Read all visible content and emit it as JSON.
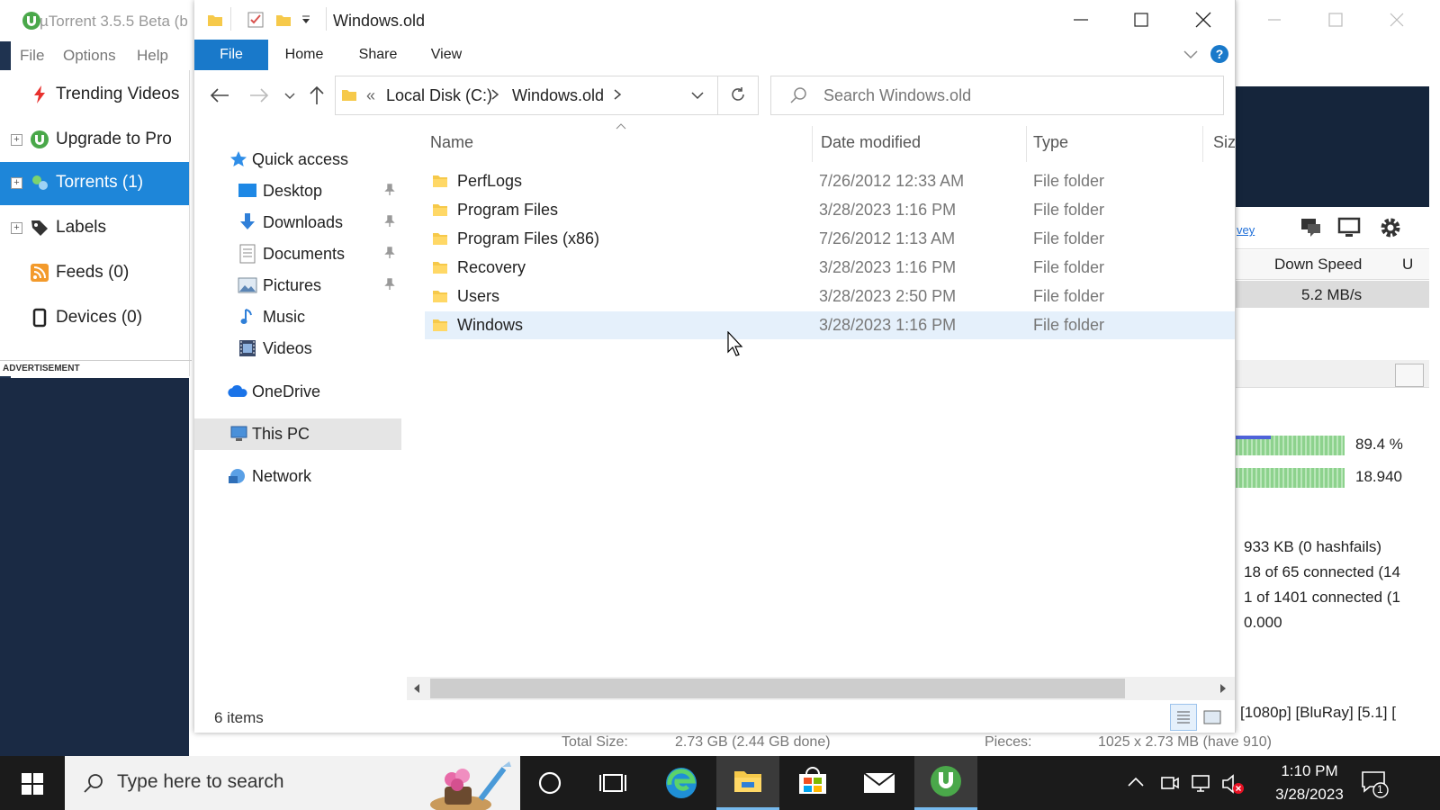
{
  "utorrent": {
    "title": "µTorrent 3.5.5 Beta (b",
    "menu": [
      "File",
      "Options",
      "Help"
    ],
    "sidebar": [
      {
        "label": "Trending Videos",
        "icon": "lightning-icon",
        "expandable": false,
        "selected": false
      },
      {
        "label": "Upgrade to Pro",
        "icon": "utorrent-logo-icon",
        "expandable": true,
        "selected": false
      },
      {
        "label": "Torrents (1)",
        "icon": "torrents-icon",
        "expandable": true,
        "selected": true
      },
      {
        "label": "Labels",
        "icon": "tag-icon",
        "expandable": true,
        "selected": false
      },
      {
        "label": "Feeds (0)",
        "icon": "rss-icon",
        "expandable": false,
        "selected": false
      },
      {
        "label": "Devices (0)",
        "icon": "device-icon",
        "expandable": false,
        "selected": false
      }
    ],
    "advertisement_label": "ADVERTISEMENT",
    "survey_link": "vey",
    "columns": {
      "down_speed": "Down Speed",
      "next": "U"
    },
    "torrent_row": {
      "down_speed": "5.2 MB/s"
    },
    "progress": {
      "availability_percent": "89.4 %",
      "availability_value": "18.940",
      "fill": 0.894
    },
    "info_lines": [
      "933 KB (0 hashfails)",
      "18 of 65 connected (14",
      "1 of 1401 connected (1",
      "0.000"
    ],
    "bottom_text": "[1080p] [BluRay] [5.1] [",
    "general": {
      "total_size_label": "Total Size:",
      "total_size_value": "2.73 GB (2.44 GB done)",
      "pieces_label": "Pieces:",
      "pieces_value": "1025 x 2.73 MB (have 910)"
    }
  },
  "explorer": {
    "title": "Windows.old",
    "ribbon_tabs": [
      "File",
      "Home",
      "Share",
      "View"
    ],
    "address": {
      "overflow": "«",
      "crumbs": [
        "Local Disk (C:)",
        "Windows.old"
      ]
    },
    "search_placeholder": "Search Windows.old",
    "tree": [
      {
        "label": "Quick access",
        "icon": "star-icon",
        "indent": 1,
        "pinned": false
      },
      {
        "label": "Desktop",
        "icon": "desktop-icon",
        "indent": 2,
        "pinned": true
      },
      {
        "label": "Downloads",
        "icon": "download-icon",
        "indent": 2,
        "pinned": true
      },
      {
        "label": "Documents",
        "icon": "documents-icon",
        "indent": 2,
        "pinned": true
      },
      {
        "label": "Pictures",
        "icon": "pictures-icon",
        "indent": 2,
        "pinned": true
      },
      {
        "label": "Music",
        "icon": "music-icon",
        "indent": 2,
        "pinned": false
      },
      {
        "label": "Videos",
        "icon": "videos-icon",
        "indent": 2,
        "pinned": false
      },
      {
        "label": "OneDrive",
        "icon": "cloud-icon",
        "indent": 1,
        "pinned": false
      },
      {
        "label": "This PC",
        "icon": "computer-icon",
        "indent": 1,
        "pinned": false,
        "selected": true
      },
      {
        "label": "Network",
        "icon": "network-icon",
        "indent": 1,
        "pinned": false
      }
    ],
    "columns": [
      "Name",
      "Date modified",
      "Type",
      "Size"
    ],
    "files": [
      {
        "name": "PerfLogs",
        "date": "7/26/2012 12:33 AM",
        "type": "File folder"
      },
      {
        "name": "Program Files",
        "date": "3/28/2023 1:16 PM",
        "type": "File folder"
      },
      {
        "name": "Program Files (x86)",
        "date": "7/26/2012 1:13 AM",
        "type": "File folder"
      },
      {
        "name": "Recovery",
        "date": "3/28/2023 1:16 PM",
        "type": "File folder"
      },
      {
        "name": "Users",
        "date": "3/28/2023 2:50 PM",
        "type": "File folder"
      },
      {
        "name": "Windows",
        "date": "3/28/2023 1:16 PM",
        "type": "File folder",
        "selected": true
      }
    ],
    "status_count": "6 items"
  },
  "taskbar": {
    "search_placeholder": "Type here to search",
    "time": "1:10 PM",
    "date": "3/28/2023",
    "notification_count": "1"
  },
  "colors": {
    "accent_blue": "#1979ca",
    "utorrent_selected": "#1e86d9",
    "folder_yellow": "#f6c94a",
    "selection_row": "#e5f0fb"
  }
}
